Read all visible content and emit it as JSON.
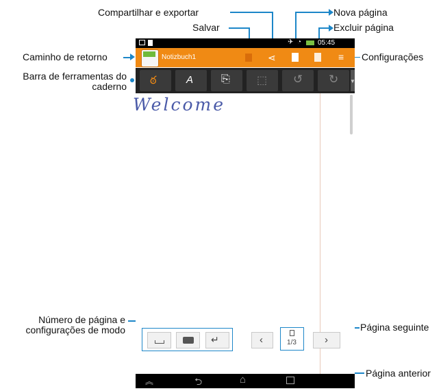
{
  "callouts": {
    "share_export": "Compartilhar e exportar",
    "save": "Salvar",
    "new_page": "Nova página",
    "delete_page": "Excluir página",
    "return_path": "Caminho de retorno",
    "settings": "Configurações",
    "toolbar_line1": "Barra de ferramentas do",
    "toolbar_line2": "caderno",
    "page_number_line1": "Número de página e",
    "page_number_line2": "configurações de modo",
    "next_page": "Página seguinte",
    "previous_page": "Página anterior"
  },
  "status_bar": {
    "time": "05:45"
  },
  "app_bar": {
    "notebook_name": "Notizbuch1"
  },
  "canvas": {
    "handwriting": "Welcome"
  },
  "page_indicator": {
    "page": "1/3"
  },
  "colors": {
    "accent_orange": "#f08a14",
    "callout_blue": "#1c86c8"
  },
  "icons": [
    "back-icon",
    "notebook-icon",
    "save-icon",
    "share-icon",
    "new-page-icon",
    "delete-page-icon",
    "settings-icon",
    "pen-icon",
    "eraser-icon",
    "import-icon",
    "select-icon",
    "undo-icon",
    "redo-icon",
    "more-icon",
    "space-icon",
    "backspace-icon",
    "enter-icon",
    "prev-page-icon",
    "next-page-icon",
    "nav-back-icon",
    "nav-home-icon",
    "nav-recent-icon"
  ]
}
